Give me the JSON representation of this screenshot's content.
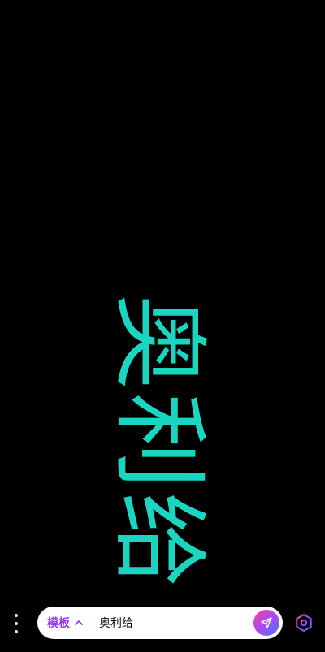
{
  "display": {
    "text": "奥利给",
    "color": "#1ad6c0"
  },
  "bottom_bar": {
    "menu_icon": "more-vertical-icon",
    "template_label": "模板",
    "template_icon": "chevron-up-icon",
    "input_value": "奥利给",
    "send_icon": "send-icon",
    "settings_icon": "hexagon-settings-icon",
    "accent_color": "#8e3cf6"
  }
}
